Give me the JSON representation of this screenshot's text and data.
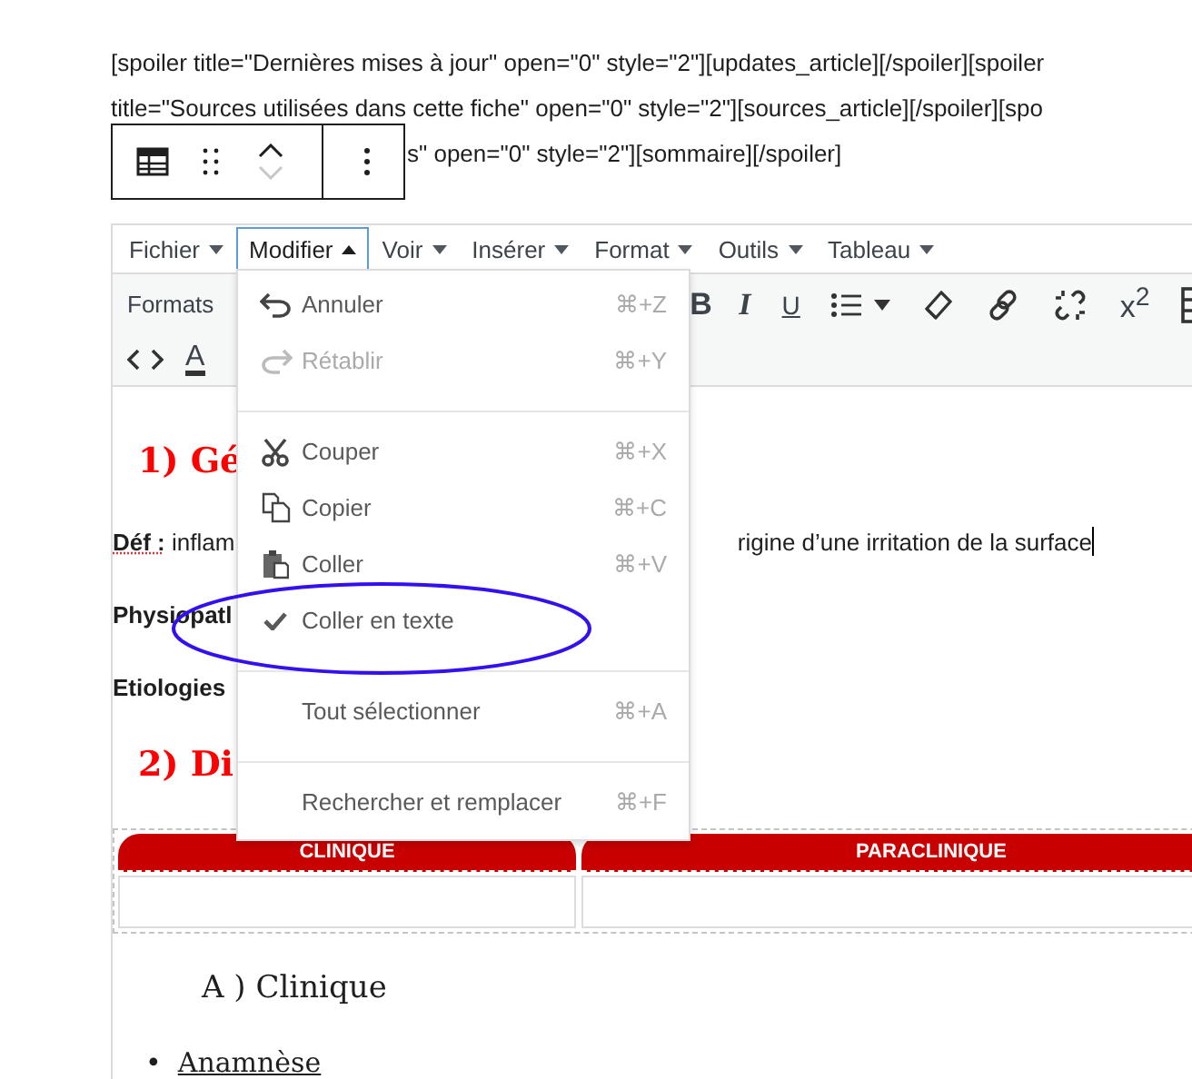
{
  "shortcode_lines": [
    "[spoiler title=\"Dernières mises à jour\" open=\"0\" style=\"2\"][updates_article][/spoiler][spoiler",
    "title=\"Sources utilisées dans cette fiche\" open=\"0\" style=\"2\"][sources_article][/spoiler][spo",
    "s\" open=\"0\" style=\"2\"][sommaire][/spoiler]"
  ],
  "block_toolbar": {
    "move_down_disabled": true
  },
  "menubar": [
    {
      "label": "Fichier",
      "selected": false
    },
    {
      "label": "Modifier",
      "selected": true
    },
    {
      "label": "Voir",
      "selected": false
    },
    {
      "label": "Insérer",
      "selected": false
    },
    {
      "label": "Format",
      "selected": false
    },
    {
      "label": "Outils",
      "selected": false
    },
    {
      "label": "Tableau",
      "selected": false
    }
  ],
  "toolbar": {
    "formats": "Formats",
    "bold": "B",
    "italic": "I",
    "underline": "U",
    "superscript": "x$^{2}$",
    "text_color": "A"
  },
  "menu": [
    {
      "kind": "item",
      "label": "Annuler",
      "shortcut": "⌘+Z",
      "disabled": false,
      "checked": false
    },
    {
      "kind": "item",
      "label": "Rétablir",
      "shortcut": "⌘+Y",
      "disabled": true,
      "checked": false
    },
    {
      "kind": "separator"
    },
    {
      "kind": "item",
      "label": "Couper",
      "shortcut": "⌘+X",
      "disabled": false,
      "checked": false
    },
    {
      "kind": "item",
      "label": "Copier",
      "shortcut": "⌘+C",
      "disabled": false,
      "checked": false
    },
    {
      "kind": "item",
      "label": "Coller",
      "shortcut": "⌘+V",
      "disabled": false,
      "checked": false
    },
    {
      "kind": "item",
      "label": "Coller en texte",
      "disabled": false,
      "checked": true
    },
    {
      "kind": "separator"
    },
    {
      "kind": "item",
      "label": "Tout sélectionner",
      "shortcut": "⌘+A",
      "disabled": false,
      "checked": false
    },
    {
      "kind": "separator"
    },
    {
      "kind": "item",
      "label": "Rechercher et remplacer",
      "shortcut": "⌘+F",
      "disabled": false,
      "checked": false
    }
  ],
  "content": {
    "heading_1": "1) Gé",
    "definition": {
      "label": "Déf :",
      "left": "inflam",
      "right": "rigine d’une irritation de la surface"
    },
    "physiopathology": "Physiopatl",
    "etiologies": "Etiologies",
    "heading_2": "2) Di",
    "table": {
      "columns": [
        "CLINIQUE",
        "PARACLINIQUE"
      ]
    },
    "subheading": "A ) Clinique",
    "list": [
      {
        "marker": "•",
        "text": "Anamnèse"
      }
    ]
  }
}
